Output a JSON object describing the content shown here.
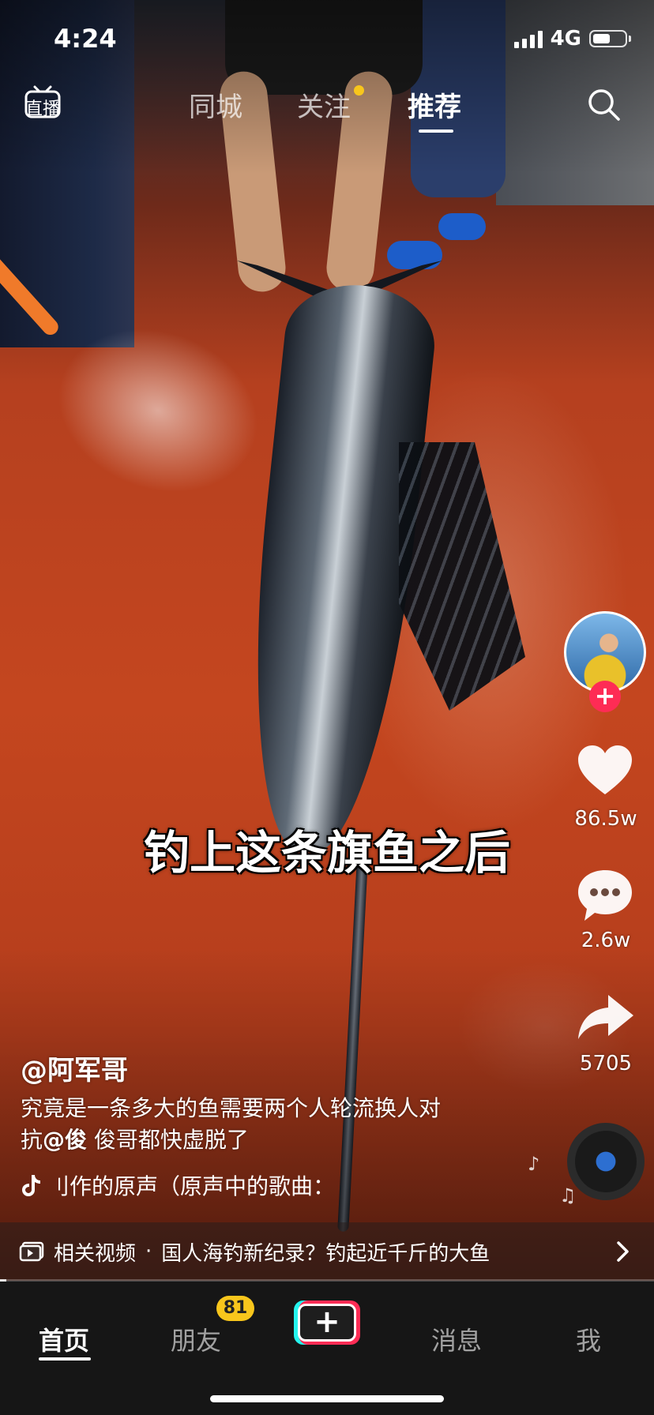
{
  "status": {
    "time": "4:24",
    "network": "4G",
    "battery_level": 0.55
  },
  "top_nav": {
    "live_label": "直播",
    "tabs": [
      {
        "label": "同城",
        "active": false
      },
      {
        "label": "关注",
        "active": false,
        "has_dot": true
      },
      {
        "label": "推荐",
        "active": true
      }
    ],
    "search_icon": "search-icon",
    "dot_color": "#f8c61c"
  },
  "video": {
    "caption": "钓上这条旗鱼之后",
    "progress": 0.01
  },
  "actions": {
    "likes": "86.5w",
    "comments": "2.6w",
    "shares": "5705",
    "follow_icon": "plus-icon",
    "accent_color": "#fe2c55"
  },
  "post": {
    "author": "@阿军哥",
    "description_line1": "究竟是一条多大的鱼需要两个人轮流换人对",
    "description_line2_prefix": "抗",
    "mention": "@俊",
    "description_line2_suffix": " 俊哥都快虚脱了",
    "music": "刂作的原声（原声中的歌曲：",
    "music_icon": "tiktok-icon"
  },
  "related": {
    "label": "相关视频",
    "separator": "·",
    "title": "国人海钓新纪录？钓起近千斤的大鱼",
    "chevron_icon": "chevron-right-icon"
  },
  "tab_bar": {
    "tabs": [
      {
        "label": "首页",
        "active": true
      },
      {
        "label": "朋友",
        "active": false,
        "badge": "81"
      },
      {
        "label": "+",
        "type": "create"
      },
      {
        "label": "消息",
        "active": false
      },
      {
        "label": "我",
        "active": false
      }
    ],
    "badge_color": "#f8c61c"
  }
}
